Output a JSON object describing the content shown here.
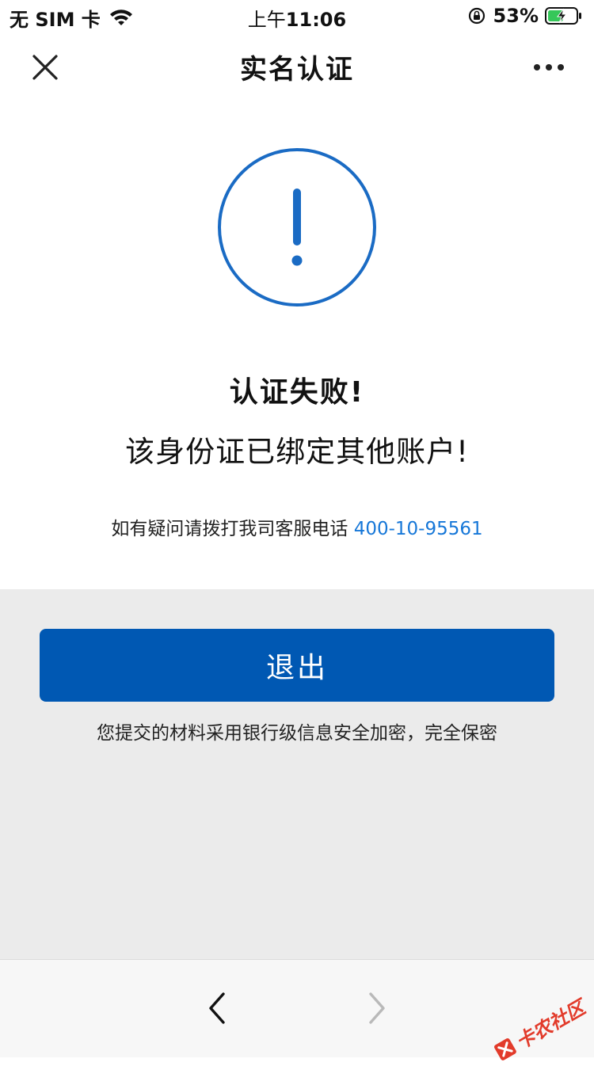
{
  "status_bar": {
    "carrier": "无 SIM 卡",
    "time_prefix": "上午",
    "time": "11:06",
    "battery": "53%"
  },
  "nav": {
    "title": "实名认证",
    "close_icon": "close-icon",
    "more_icon": "more-icon"
  },
  "result": {
    "icon": "exclamation-circle-icon",
    "title": "认证失败!",
    "message": "该身份证已绑定其他账户!",
    "contact_text": "如有疑问请拨打我司客服电话",
    "phone": "400-10-95561"
  },
  "actions": {
    "exit_label": "退出",
    "security_note": "您提交的材料采用银行级信息安全加密，完全保密"
  },
  "toolbar": {
    "back_icon": "chevron-left-icon",
    "forward_icon": "chevron-right-icon"
  },
  "watermark": {
    "text": "卡农社区"
  },
  "colors": {
    "accent": "#0058b3",
    "link": "#1677d8",
    "icon_blue": "#1a6bc4",
    "gray_bg": "#ebebeb"
  }
}
